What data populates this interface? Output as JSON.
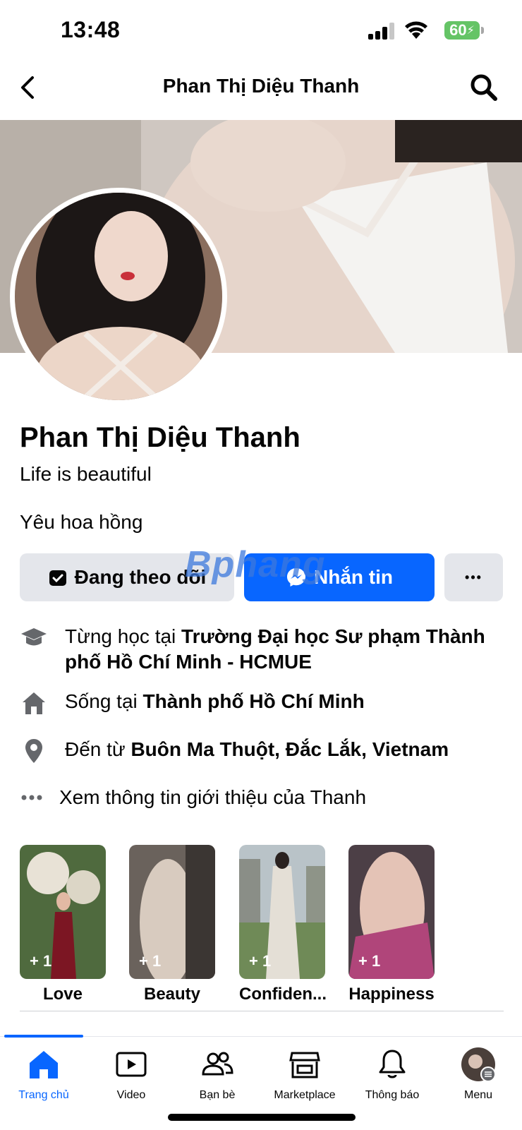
{
  "status_bar": {
    "time": "13:48",
    "battery": "60"
  },
  "nav": {
    "title": "Phan Thị Diệu Thanh"
  },
  "profile": {
    "name": "Phan Thị Diệu Thanh",
    "bio": "Life is beautiful",
    "quote": "Yêu hoa hồng"
  },
  "actions": {
    "follow_label": "Đang theo dõi",
    "message_label": "Nhắn tin",
    "more_label": "•••"
  },
  "watermark": "Bphang",
  "info": [
    {
      "prefix": "Từng học tại ",
      "bold": "Trường Đại học Sư phạm Thành phố Hồ Chí Minh - HCMUE",
      "icon": "graduation-cap-icon"
    },
    {
      "prefix": "Sống tại ",
      "bold": "Thành phố Hồ Chí Minh",
      "icon": "home-icon"
    },
    {
      "prefix": "Đến từ ",
      "bold": "Buôn Ma Thuột, Đắc Lắk, Vietnam",
      "icon": "location-pin-icon"
    }
  ],
  "see_about": "Xem thông tin giới thiệu của Thanh",
  "highlights": [
    {
      "label": "Love",
      "count": "+ 1",
      "color": "#6b7a55"
    },
    {
      "label": "Beauty",
      "count": "+ 1",
      "color": "#8f8a82"
    },
    {
      "label": "Confiden...",
      "count": "+ 1",
      "color": "#7e8c6a"
    },
    {
      "label": "Happiness",
      "count": "+ 1",
      "color": "#b0457a"
    }
  ],
  "tabs": [
    {
      "label": "Trang chủ",
      "icon": "home-icon",
      "active": true
    },
    {
      "label": "Video",
      "icon": "video-icon",
      "active": false
    },
    {
      "label": "Bạn bè",
      "icon": "friends-icon",
      "active": false
    },
    {
      "label": "Marketplace",
      "icon": "marketplace-icon",
      "active": false
    },
    {
      "label": "Thông báo",
      "icon": "bell-icon",
      "active": false
    },
    {
      "label": "Menu",
      "icon": "profile-avatar-icon",
      "active": false
    }
  ],
  "colors": {
    "accent": "#0866ff",
    "secondary_button": "#e4e6eb",
    "battery": "#65c466"
  }
}
